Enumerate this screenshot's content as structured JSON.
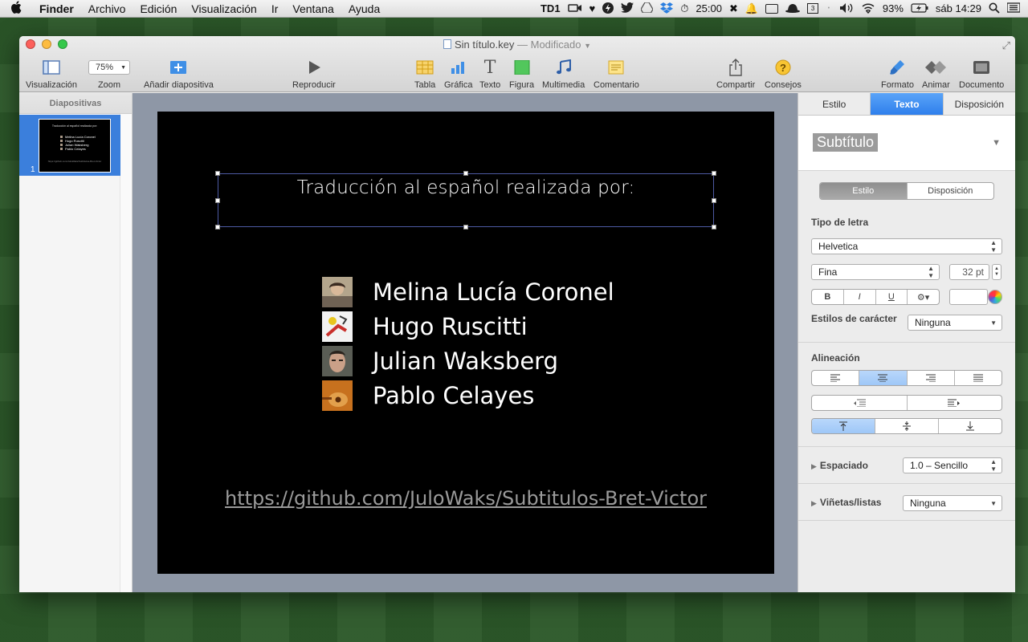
{
  "menubar": {
    "apple": "",
    "items": [
      "Finder",
      "Archivo",
      "Edición",
      "Visualización",
      "Ir",
      "Ventana",
      "Ayuda"
    ],
    "status": {
      "td_label": "TD",
      "td_count": "1",
      "timer": "25:00",
      "calendar_day": "3",
      "battery": "93%",
      "clock": "sáb 14:29"
    }
  },
  "window": {
    "title": "Sin título.key",
    "modified": "— Modificado",
    "toolbar": {
      "view_label": "Visualización",
      "zoom_value": "75%",
      "zoom_label": "Zoom",
      "add_slide_label": "Añadir diapositiva",
      "play_label": "Reproducir",
      "table_label": "Tabla",
      "chart_label": "Gráfica",
      "text_label": "Texto",
      "shape_label": "Figura",
      "media_label": "Multimedia",
      "comment_label": "Comentario",
      "share_label": "Compartir",
      "tips_label": "Consejos",
      "format_label": "Formato",
      "animate_label": "Animar",
      "document_label": "Documento"
    }
  },
  "navigator": {
    "header": "Diapositivas",
    "slide_number": "1"
  },
  "slide": {
    "title": "Traducción al español realizada por:",
    "credits": [
      "Melina Lucía Coronel",
      "Hugo Ruscitti",
      "Julian Waksberg",
      "Pablo Celayes"
    ],
    "url": "https://github.com/JuloWaks/Subtitulos-Bret-Victor"
  },
  "inspector": {
    "tabs": [
      "Estilo",
      "Texto",
      "Disposición"
    ],
    "active_tab": "Texto",
    "paragraph_style": "Subtítulo",
    "sub_tabs": [
      "Estilo",
      "Disposición"
    ],
    "font_section": "Tipo de letra",
    "font_family": "Helvetica",
    "font_weight": "Fina",
    "font_size": "32 pt",
    "bold": "B",
    "italic": "I",
    "underline": "U",
    "char_styles_label": "Estilos de carácter",
    "char_styles_value": "Ninguna",
    "alignment_label": "Alineación",
    "spacing_label": "Espaciado",
    "spacing_value": "1.0 – Sencillo",
    "bullets_label": "Viñetas/listas",
    "bullets_value": "Ninguna"
  }
}
